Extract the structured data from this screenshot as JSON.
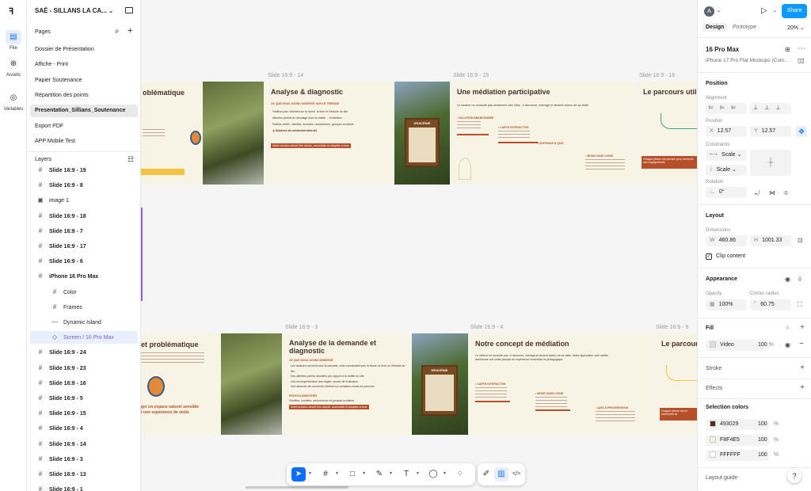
{
  "project": {
    "name": "SAÉ - SILLANS LA CA...",
    "caret": "⌄"
  },
  "rail": [
    {
      "label": "File",
      "icon": "file-icon",
      "glyph": "▤"
    },
    {
      "label": "Assets",
      "icon": "assets-icon",
      "glyph": "⊕"
    },
    {
      "label": "Variables",
      "icon": "variables-icon",
      "glyph": "◎"
    }
  ],
  "pages": {
    "title": "Pages",
    "items": [
      "Dossier de Présentation",
      "Affiche - Print",
      "Papier Soutenance",
      "Répartition des points",
      "Presentation_Sillians_Soutenance",
      "Export PDF",
      "APP Mobile Test"
    ],
    "selected": 4
  },
  "layers": {
    "title": "Layers",
    "items": [
      {
        "label": "Slide 16:9 - 19",
        "icon": "#",
        "indent": 0
      },
      {
        "label": "Slide 16:9 - 8",
        "icon": "#",
        "indent": 0
      },
      {
        "label": "image 1",
        "icon": "▣",
        "indent": 0,
        "plain": true
      },
      {
        "label": "Slide 16:9 - 18",
        "icon": "#",
        "indent": 0
      },
      {
        "label": "Slide 16:9 - 7",
        "icon": "#",
        "indent": 0
      },
      {
        "label": "Slide 16:9 - 17",
        "icon": "#",
        "indent": 0
      },
      {
        "label": "Slide 16:9 - 6",
        "icon": "#",
        "indent": 0
      },
      {
        "label": "iPhone 16 Pro Max",
        "icon": "#",
        "indent": 0
      },
      {
        "label": "Color",
        "icon": "#",
        "indent": 1
      },
      {
        "label": "Frames",
        "icon": "#",
        "indent": 1
      },
      {
        "label": "Dynamic Island",
        "icon": "—",
        "indent": 1
      },
      {
        "label": "Screen / 16 Pro Max",
        "icon": "◇",
        "indent": 1,
        "selected": true
      },
      {
        "label": "Slide 16:9 - 24",
        "icon": "#",
        "indent": 0
      },
      {
        "label": "Slide 16:9 - 23",
        "icon": "#",
        "indent": 0
      },
      {
        "label": "Slide 16:9 - 16",
        "icon": "#",
        "indent": 0
      },
      {
        "label": "Slide 16:9 - 5",
        "icon": "#",
        "indent": 0
      },
      {
        "label": "Slide 16:9 - 15",
        "icon": "#",
        "indent": 0
      },
      {
        "label": "Slide 16:9 - 4",
        "icon": "#",
        "indent": 0
      },
      {
        "label": "Slide 16:9 - 14",
        "icon": "#",
        "indent": 0
      },
      {
        "label": "Slide 16:9 - 3",
        "icon": "#",
        "indent": 0
      },
      {
        "label": "Slide 16:9 - 13",
        "icon": "#",
        "indent": 0
      },
      {
        "label": "Slide 16:9 - 1",
        "icon": "#",
        "indent": 0
      }
    ]
  },
  "canvas": {
    "frame_labels": [
      "Slide 16:9 - 14",
      "Slide 16:9 - 15",
      "Slide 16:9 - 16",
      "Slide 16:9 - 3",
      "Slide 16:9 - 4",
      "Slide 16:9 - 5"
    ],
    "slides": {
      "s1": {
        "title": "oblématique"
      },
      "s2": {
        "title": "Analyse & diagnostic",
        "sub": "CE QUE NOUS AVONS OBSERVÉ SUR LE TERRAIN",
        "bullets": [
          "Visiteurs peu informés sur la faune, la flore et l'histoire du site",
          "Attentes parfois en décalage avec la réalité → frustration",
          "Publics variés : familles, touristes, randonneurs, groupes scolaires",
          "⚠ Absence de connexion internet"
        ],
        "note": "Notre solution devait être simple, accessible et adaptée à tous."
      },
      "s3": {
        "title": "Une médiation participative",
        "intro": "Le visiteur ne consulte pas seulement des infos : il découvre, interagit et devient acteur de sa visite",
        "sign": "DRACÉNIE",
        "labels": [
          "• SOLUTION ABANDONNÉE",
          "• CARTE INTERACTIVE",
          "• CONTENUS & QUIZ",
          "• MODE SANS LIGNE"
        ]
      },
      "s4": {
        "title": "Le parcours util",
        "note": "Chaque phase est pensée pour renforcer ses engagements"
      },
      "s5": {
        "title": "et problématique",
        "tagline": "ger un espace naturel sensible\nt une expérience de visite"
      },
      "s6": {
        "title": "Analyse de la demande et\ndiagnostic",
        "sub": "CE QUE NOUS AVONS OBSERVÉ",
        "bullets": [
          "Les visiteurs viennent pour la cascade, mais connaissent peu la faune, la flore ou l'histoire du lieu",
          "Des attentes parfois décalées par rapport à la réalité du site",
          "Une incompréhension des règles, source de frustration",
          "Une absence de connexion internet sur certaines zones du parcours"
        ],
        "profiles_title": "PROFILS IDENTIFIÉS",
        "profiles": "Familles, touristes, randonneurs et groupes scolaires",
        "note": "Notre solution devait être simple, accessible et adaptée à tous."
      },
      "s7": {
        "title": "Notre concept de médiation",
        "intro": "Le visiteur ne consulte pas : il découvre, interagit et devient acteur de sa visite. Notre application web mobile transforme une visite passive en expérience immersive et pédagogique",
        "sign": "DRACÉNIE",
        "labels": [
          "• CARTE INTERACTIVE",
          "• MODE SANS LIGNE",
          "• QUIZ & PROGRESSION"
        ]
      },
      "s8": {
        "title": "Le parcour",
        "note": "Chaque phase est en renforçant se"
      }
    }
  },
  "toolbar": {
    "tools": [
      {
        "name": "move-tool",
        "glyph": "➤"
      },
      {
        "name": "frame-tool",
        "glyph": "#"
      },
      {
        "name": "shape-tool",
        "glyph": "□"
      },
      {
        "name": "pen-tool",
        "glyph": "✎"
      },
      {
        "name": "text-tool",
        "glyph": "T"
      },
      {
        "name": "comment-tool",
        "glyph": "◯"
      },
      {
        "name": "components-tool",
        "glyph": "⁘"
      },
      {
        "name": "draw-mode",
        "glyph": "✐"
      },
      {
        "name": "design-mode",
        "glyph": "▥"
      },
      {
        "name": "dev-mode",
        "glyph": "</>"
      }
    ]
  },
  "right": {
    "avatar": "A",
    "share": "Share",
    "tabs": [
      "Design",
      "Prototype"
    ],
    "zoom": "20%",
    "selection": {
      "name": "16 Pro Max",
      "component": "iPhone 17 Pro Flat Mockups (Com..."
    },
    "position": {
      "title": "Position",
      "alignment": "Alignment",
      "pos_label": "Position",
      "x": "12.57",
      "y": "12.57",
      "constraints": "Constraints",
      "ch": "Scale",
      "cv": "Scale",
      "rotation": "Rotation",
      "rot": "0°"
    },
    "layout": {
      "title": "Layout",
      "dimensions": "Dimensions",
      "w": "460.86",
      "h": "1001.33",
      "clip": "Clip content"
    },
    "appearance": {
      "title": "Appearance",
      "opacity_label": "Opacity",
      "opacity": "100%",
      "radius_label": "Corner radius",
      "radius": "60.75"
    },
    "fill": {
      "title": "Fill",
      "name": "Video",
      "pct": "100",
      "unit": "%"
    },
    "sections": [
      "Stroke",
      "Effects"
    ],
    "colors": {
      "title": "Selection colors",
      "items": [
        {
          "hex": "493029",
          "color": "#493029",
          "pct": "100"
        },
        {
          "hex": "F8F4E5",
          "color": "#F8F4E5",
          "pct": "100"
        },
        {
          "hex": "FFFFFF",
          "color": "#FFFFFF",
          "pct": "100"
        }
      ]
    },
    "layout_guide": "Layout guide",
    "help": "?"
  }
}
